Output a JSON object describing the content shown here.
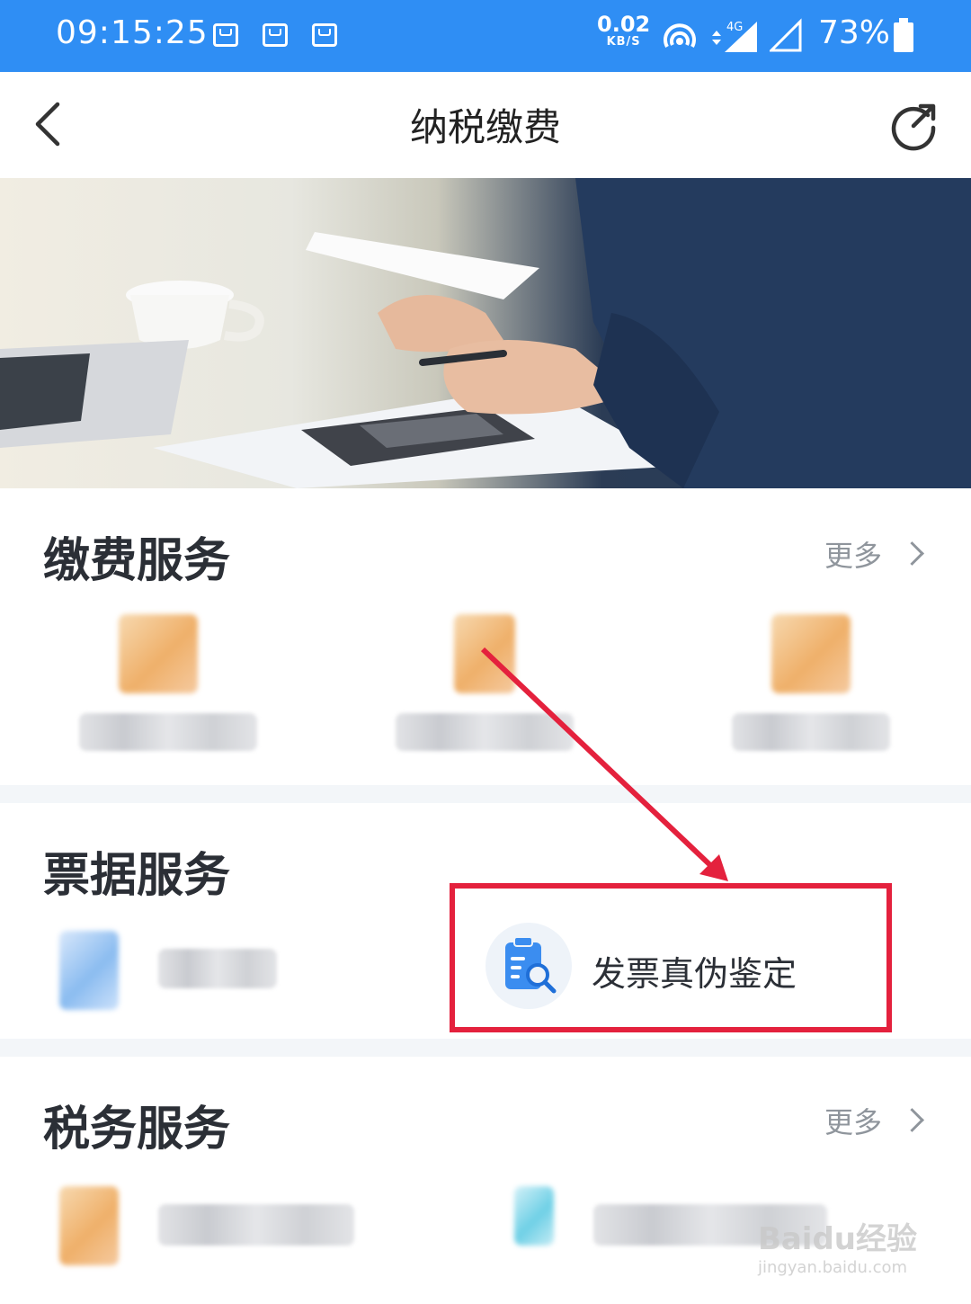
{
  "status_bar": {
    "time": "09:15:25",
    "net_speed_value": "0.02",
    "net_speed_unit": "KB/S",
    "network_type": "4G",
    "battery": "73%"
  },
  "header": {
    "title": "纳税缴费",
    "back_icon": "chevron-left-icon",
    "share_icon": "share-icon"
  },
  "sections": {
    "payment": {
      "title": "缴费服务",
      "more": "更多"
    },
    "invoice": {
      "title": "票据服务",
      "featured_item": "发票真伪鉴定"
    },
    "tax": {
      "title": "税务服务",
      "more": "更多"
    }
  },
  "annotation": {
    "color": "#e4213d"
  },
  "watermark": {
    "brand": "Baidu经验",
    "url": "jingyan.baidu.com"
  },
  "colors": {
    "status_bar": "#2f8ef4",
    "title_text": "#2b2f36",
    "muted": "#8f959c"
  }
}
